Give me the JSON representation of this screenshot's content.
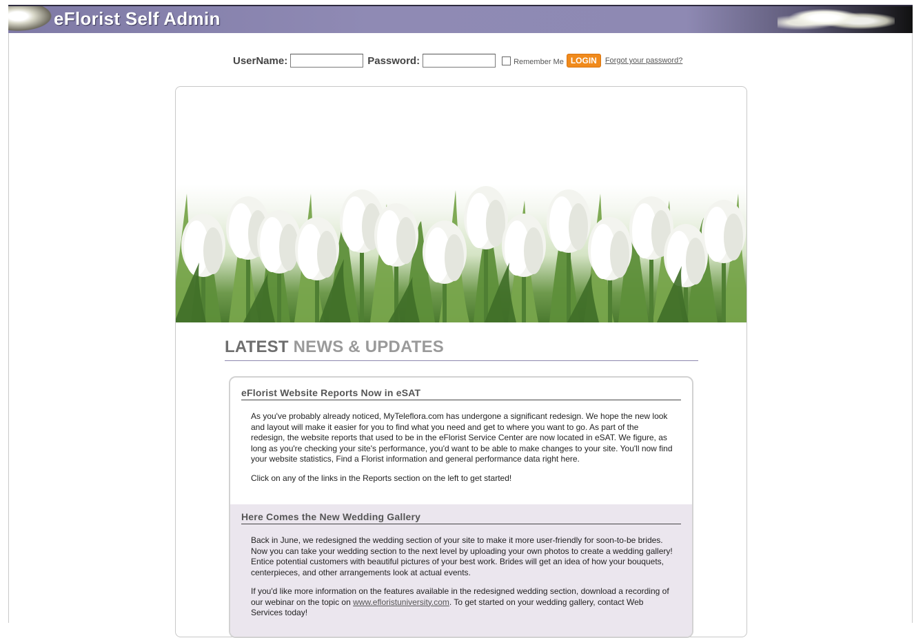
{
  "header": {
    "title": "eFlorist Self Admin"
  },
  "login": {
    "username_label": "UserName:",
    "password_label": "Password:",
    "username_value": "",
    "password_value": "",
    "remember_label": "Remember Me",
    "login_button": "LOGIN",
    "forgot_link": "Forgot your password?"
  },
  "news": {
    "title_primary": "LATEST",
    "title_secondary": "NEWS & UPDATES",
    "articles": [
      {
        "title": "eFlorist Website Reports Now in eSAT",
        "p1": "As you've probably already noticed, MyTeleflora.com has undergone a significant redesign. We hope the new look and layout will make it easier for you to find what you need and get to where you want to go. As part of the redesign, the website reports that used to be in the eFlorist Service Center are now located in eSAT. We figure, as long as you're checking your site's performance, you'd want to be able to make changes to your site. You'll now find your website statistics, Find a Florist information and general performance data right here.",
        "p2": "Click on any of the links in the Reports section on the left to get started!"
      },
      {
        "title": "Here Comes the New Wedding Gallery",
        "p1": "Back in June, we redesigned the wedding section of your site to make it more user-friendly for soon-to-be brides. Now you can take your wedding section to the next level by uploading your own photos to create a wedding gallery! Entice potential customers with beautiful pictures of your best work. Brides will get an idea of how your bouquets, centerpieces, and other arrangements look at actual events.",
        "p2_before": "If you'd like more information on the features available in the redesigned wedding section, download a recording of our webinar on the topic on ",
        "p2_link": "www.efloristuniversity.com",
        "p2_after": ". To get started on your wedding gallery, contact Web Services today!"
      }
    ]
  },
  "colors": {
    "header_bar": "#8e89b3",
    "login_button": "#f08a1c",
    "article_alt_bg": "#ebe6ee",
    "rule": "#8c86ae"
  },
  "icons": {
    "hero": "white-tulips-banner"
  }
}
